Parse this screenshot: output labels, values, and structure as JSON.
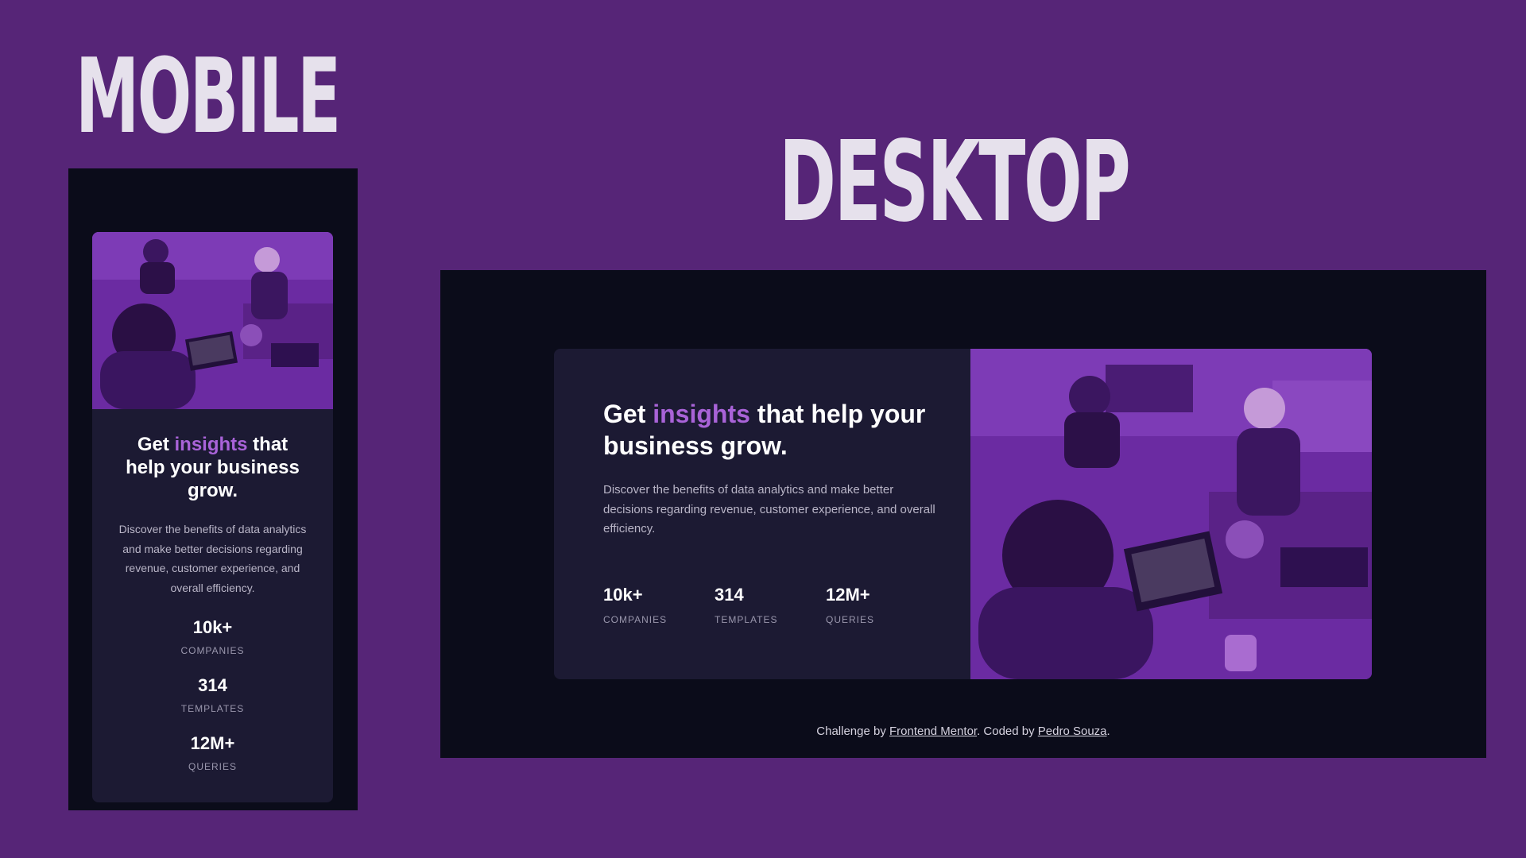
{
  "labels": {
    "mobile": "MOBILE",
    "desktop": "DESKTOP"
  },
  "card": {
    "headline_start": "Get ",
    "headline_accent": "insights",
    "headline_end": " that help your business grow.",
    "description": "Discover the benefits of data analytics and make better decisions regarding revenue, customer experience, and overall efficiency.",
    "stats": [
      {
        "value": "10k+",
        "label": "Companies"
      },
      {
        "value": "314",
        "label": "Templates"
      },
      {
        "value": "12M+",
        "label": "Queries"
      }
    ],
    "image_alt": "People working at laptops in an office, tinted purple"
  },
  "attribution": {
    "prefix": "Challenge by ",
    "link1": "Frontend Mentor",
    "middle": ". Coded by ",
    "link2": "Pedro Souza",
    "suffix": "."
  },
  "colors": {
    "page_bg": "#562577",
    "frame_bg": "#0b0c1a",
    "card_bg": "#1c1a33",
    "accent": "#a963d8",
    "title": "#e6e1ec"
  }
}
